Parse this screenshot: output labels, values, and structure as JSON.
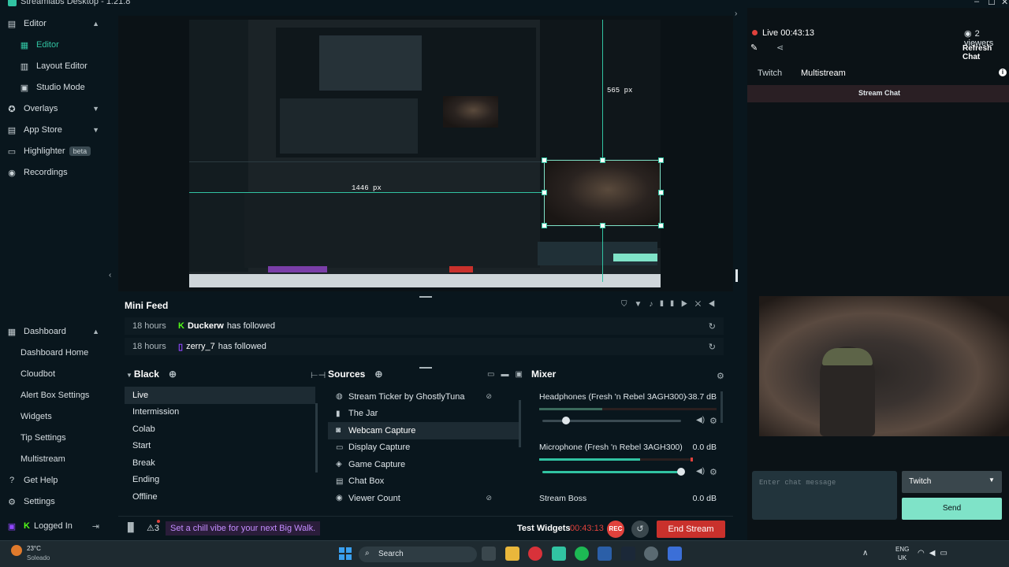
{
  "titlebar": {
    "title": "Streamlabs Desktop - 1.21.8"
  },
  "sidebar": {
    "editor": "Editor",
    "editor_sub": [
      "Editor",
      "Layout Editor",
      "Studio Mode"
    ],
    "overlays": "Overlays",
    "app_store": "App Store",
    "highlighter": "Highlighter",
    "highlighter_badge": "beta",
    "recordings": "Recordings",
    "dashboard": "Dashboard",
    "dashboard_items": [
      "Dashboard Home",
      "Cloudbot",
      "Alert Box Settings",
      "Widgets",
      "Tip Settings",
      "Multistream"
    ],
    "get_help": "Get Help",
    "settings": "Settings",
    "logged_in": "Logged In"
  },
  "preview": {
    "width_label": "1446  px",
    "height_label": "565  px"
  },
  "mini_feed": {
    "title": "Mini Feed",
    "rows": [
      {
        "time": "18 hours",
        "name": "Duckerw",
        "action": "has followed"
      },
      {
        "time": "18 hours",
        "name": "zerry_7",
        "action": "has followed"
      }
    ]
  },
  "scenes": {
    "title": "Black",
    "items": [
      "Live",
      "Intermission",
      "Colab",
      "Start",
      "Break",
      "Ending",
      "Offline"
    ],
    "selected": "Live"
  },
  "sources": {
    "title": "Sources",
    "items": [
      "Stream Ticker by GhostlyTuna",
      "The Jar",
      "Webcam Capture",
      "Display Capture",
      "Game Capture",
      "Chat Box",
      "Viewer Count"
    ],
    "selected": "Webcam Capture"
  },
  "mixer": {
    "title": "Mixer",
    "channels": [
      {
        "name": "Headphones (Fresh 'n Rebel 3AGH300)",
        "db": "-38.7 dB",
        "level": 0.17
      },
      {
        "name": "Microphone (Fresh 'n Rebel 3AGH300)",
        "db": "0.0 dB",
        "level": 1.0
      },
      {
        "name": "Stream Boss",
        "db": "0.0 dB"
      }
    ]
  },
  "bottom": {
    "alerts_count": "3",
    "ticker_text": "Set a chill vibe for your next Big Walk.",
    "test_widgets": "Test Widgets",
    "timer": "00:43:13",
    "rec": "REC",
    "end_stream": "End Stream"
  },
  "right": {
    "live_label": "Live 00:43:13",
    "viewers": "2 viewers",
    "refresh_chat": "Refresh Chat",
    "tabs": [
      "Twitch",
      "Multistream"
    ],
    "active_tab": "Multistream",
    "stream_chat": "Stream Chat",
    "chat_placeholder": "Enter chat message",
    "platform_select": "Twitch",
    "send": "Send"
  },
  "taskbar": {
    "weather_temp": "23°C",
    "weather_text": "Soleado",
    "search": "Search",
    "lang1": "ENG",
    "lang2": "UK"
  },
  "colors": {
    "accent": "#31c3a2",
    "rec_red": "#e0413c",
    "end_red": "#c9312c",
    "bg": "#09161d"
  }
}
